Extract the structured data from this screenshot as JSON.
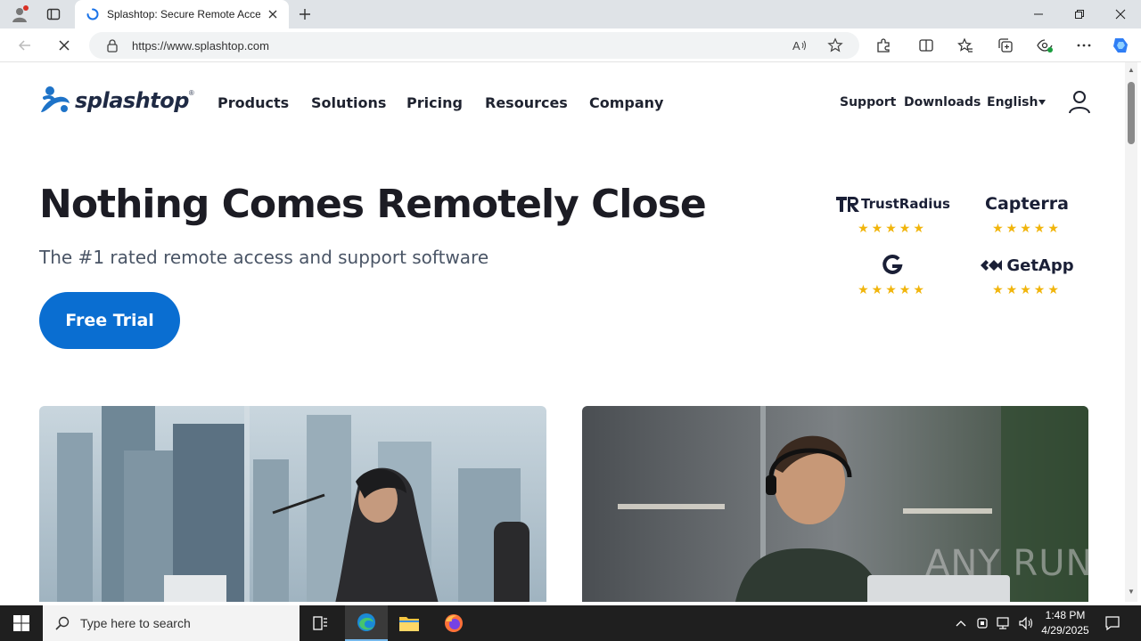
{
  "browser": {
    "tab_title": "Splashtop: Secure Remote Access",
    "url": "https://www.splashtop.com"
  },
  "site": {
    "logo_text": "splashtop",
    "nav": [
      "Products",
      "Solutions",
      "Pricing",
      "Resources",
      "Company"
    ],
    "nav_right": {
      "support": "Support",
      "downloads": "Downloads",
      "language": "English"
    },
    "hero": {
      "title": "Nothing Comes Remotely Close",
      "subtitle": "The #1 rated remote access and support software",
      "cta": "Free Trial"
    },
    "ratings": [
      {
        "name": "TrustRadius",
        "stars": 5
      },
      {
        "name": "Capterra",
        "stars": 5
      },
      {
        "name": "G2",
        "stars": 5
      },
      {
        "name": "GetApp",
        "stars": 5
      }
    ]
  },
  "watermark": "ANY RUN",
  "taskbar": {
    "search_placeholder": "Type here to search",
    "time": "1:48 PM",
    "date": "4/29/2025"
  },
  "colors": {
    "cta": "#0a6ed1",
    "stars": "#f1b50c",
    "brand_dark": "#1f2a44",
    "logo_blue": "#1e73c8"
  }
}
